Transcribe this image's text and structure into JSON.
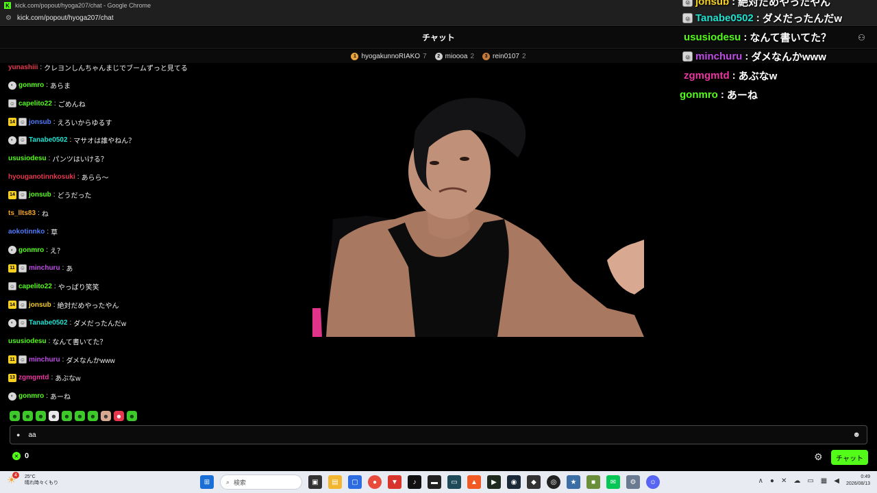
{
  "browser": {
    "window_title": "kick.com/popout/hyoga207/chat - Google Chrome",
    "url": "kick.com/popout/hyoga207/chat"
  },
  "chat": {
    "header_title": "チャット",
    "leaderboard": [
      {
        "rank": "1",
        "name": "hyogakunnoRIAKO",
        "count": "7",
        "color": "#e6a23c"
      },
      {
        "rank": "2",
        "name": "mioooa",
        "count": "2",
        "color": "#cfcfcf"
      },
      {
        "rank": "3",
        "name": "rein0107",
        "count": "2",
        "color": "#c47a3a"
      }
    ],
    "messages": [
      {
        "user": "yunashiii",
        "text": "クレヨンしんちゃんまじでブームずっと見てる",
        "color": "#e8384f",
        "badges": []
      },
      {
        "user": "gonmro",
        "text": "あらま",
        "color": "#53fc18",
        "badges": [
          "circle"
        ]
      },
      {
        "user": "capelito22",
        "text": "ごめんね",
        "color": "#53fc18",
        "badges": [
          "mask"
        ]
      },
      {
        "user": "jonsub",
        "text": "えろいからゆるす",
        "color": "#4f7cff",
        "badges": [
          "14",
          "mask"
        ]
      },
      {
        "user": "Tanabe0502",
        "text": "マサオは誰やねん？",
        "color": "#20e0d0",
        "badges": [
          "circle",
          "mask"
        ]
      },
      {
        "user": "ususiodesu",
        "text": "パンツはいける？",
        "color": "#53fc18",
        "badges": []
      },
      {
        "user": "hyouganotinnkosuki",
        "text": "あらら〜",
        "color": "#e8384f",
        "badges": []
      },
      {
        "user": "jonsub",
        "text": "どうだった",
        "color": "#53fc18",
        "badges": [
          "14",
          "mask"
        ]
      },
      {
        "user": "ts_llts83",
        "text": "ね",
        "color": "#f5a623",
        "badges": []
      },
      {
        "user": "aokotinnko",
        "text": "草",
        "color": "#4f7cff",
        "badges": []
      },
      {
        "user": "gonmro",
        "text": "え？",
        "color": "#53fc18",
        "badges": [
          "circle"
        ]
      },
      {
        "user": "minchuru",
        "text": "あ",
        "color": "#c04ce8",
        "badges": [
          "11",
          "mask"
        ]
      },
      {
        "user": "capelito22",
        "text": "やっぱり笑笑",
        "color": "#53fc18",
        "badges": [
          "mask"
        ]
      },
      {
        "user": "jonsub",
        "text": "絶対だめやったやん",
        "color": "#f5d020",
        "badges": [
          "14",
          "mask"
        ]
      },
      {
        "user": "Tanabe0502",
        "text": "ダメだったんだw",
        "color": "#20e0d0",
        "badges": [
          "circle",
          "mask"
        ]
      },
      {
        "user": "ususiodesu",
        "text": "なんて書いてた？",
        "color": "#53fc18",
        "badges": []
      },
      {
        "user": "minchuru",
        "text": "ダメなんかwww",
        "color": "#c04ce8",
        "badges": [
          "11",
          "mask"
        ]
      },
      {
        "user": "zgmgmtd",
        "text": "あぶなw",
        "color": "#e8389f",
        "badges": [
          "13"
        ]
      },
      {
        "user": "gonmro",
        "text": "あーね",
        "color": "#53fc18",
        "badges": [
          "circle"
        ]
      }
    ],
    "input_value": "aa",
    "points_value": "0",
    "send_label": "チャット"
  },
  "overlay": {
    "messages": [
      {
        "user": "jonsub",
        "text": "絶対だめやったやん",
        "color": "#f5d020",
        "badge": true
      },
      {
        "user": "Tanabe0502",
        "text": "ダメだったんだw",
        "color": "#20e0d0",
        "badge": true
      },
      {
        "user": "ususiodesu",
        "text": "なんて書いてた？",
        "color": "#53fc18",
        "badge": false
      },
      {
        "user": "minchuru",
        "text": "ダメなんかwww",
        "color": "#c04ce8",
        "badge": true
      },
      {
        "user": "zgmgmtd",
        "text": "あぶなw",
        "color": "#e8389f",
        "badge": false
      },
      {
        "user": "gonmro",
        "text": "あーね",
        "color": "#53fc18",
        "badge": false
      }
    ]
  },
  "taskbar": {
    "weather_temp": "25°C",
    "weather_desc": "晴れ時々くもり",
    "weather_alert_count": "4",
    "search_placeholder": "検索",
    "time": "0:49",
    "date": "2026/08/13"
  }
}
